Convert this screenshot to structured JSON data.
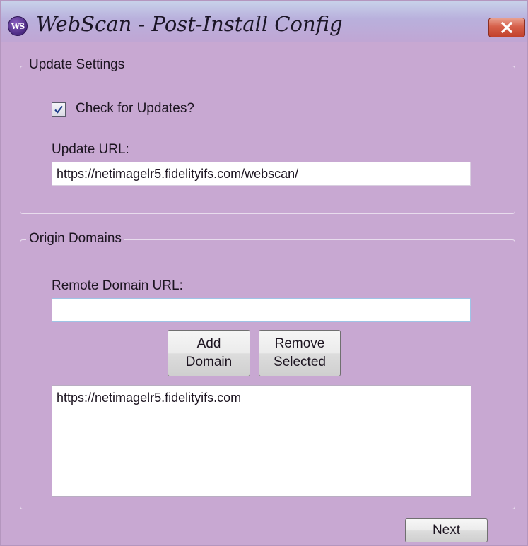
{
  "window": {
    "icon_text": "WS",
    "title": "WebScan - Post-Install Config",
    "close_icon": "close-icon"
  },
  "update_settings": {
    "legend": "Update Settings",
    "check_for_updates": {
      "label": "Check for Updates?",
      "checked": true
    },
    "update_url_label": "Update URL:",
    "update_url_value": "https://netimagelr5.fidelityifs.com/webscan/"
  },
  "origin_domains": {
    "legend": "Origin Domains",
    "remote_domain_label": "Remote Domain URL:",
    "remote_domain_value": "",
    "add_button": {
      "line1": "Add",
      "line2": "Domain"
    },
    "remove_button": {
      "line1": "Remove",
      "line2": "Selected"
    },
    "domains": [
      "https://netimagelr5.fidelityifs.com"
    ]
  },
  "footer": {
    "next_label": "Next"
  },
  "colors": {
    "window_bg": "#c8a8d2",
    "close_button": "#c2412c"
  }
}
